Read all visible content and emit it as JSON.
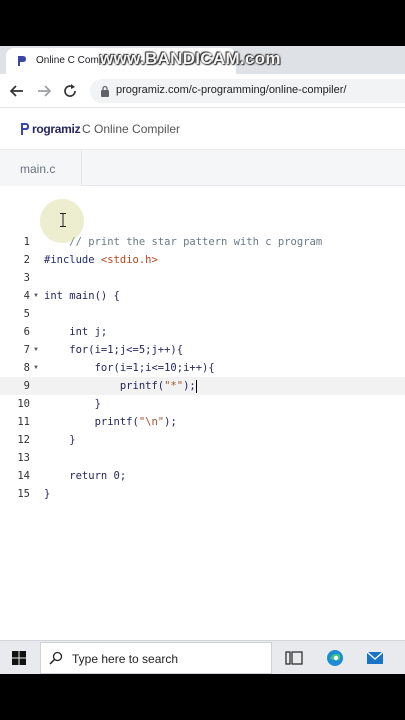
{
  "browser": {
    "tab_title": "Online C Compiler",
    "watermark": "www.BANDICAM.com",
    "url": "programiz.com/c-programming/online-compiler/"
  },
  "site": {
    "logo_text": "rogramiz",
    "title": "C Online Compiler"
  },
  "editor": {
    "file_tab": "main.c",
    "active_line": 9,
    "lines": [
      {
        "n": "1",
        "html": "    <span class=\"cm\">// print the star pattern with c program</span>",
        "fold": false
      },
      {
        "n": "2",
        "html": "<span class=\"pp\">#include</span> <span class=\"inc\">&lt;stdio.h&gt;</span>",
        "fold": false
      },
      {
        "n": "3",
        "html": "",
        "fold": false
      },
      {
        "n": "4",
        "html": "int main() {",
        "fold": true
      },
      {
        "n": "5",
        "html": "",
        "fold": false
      },
      {
        "n": "6",
        "html": "    int j;",
        "fold": false
      },
      {
        "n": "7",
        "html": "    for(i=1;j&lt;=5;j++){",
        "fold": true
      },
      {
        "n": "8",
        "html": "        for(i=1;i&lt;=10;i++){",
        "fold": true
      },
      {
        "n": "9",
        "html": "            printf(<span class=\"str\">\"*\"</span>);",
        "fold": false
      },
      {
        "n": "10",
        "html": "        }",
        "fold": false
      },
      {
        "n": "11",
        "html": "        printf(<span class=\"str\">\"\\n\"</span>);",
        "fold": false
      },
      {
        "n": "12",
        "html": "    }",
        "fold": false
      },
      {
        "n": "13",
        "html": "",
        "fold": false
      },
      {
        "n": "14",
        "html": "    return 0;",
        "fold": false
      },
      {
        "n": "15",
        "html": "}",
        "fold": false
      }
    ]
  },
  "taskbar": {
    "search_placeholder": "Type here to search"
  },
  "colors": {
    "accent": "#25265e",
    "tab_bg": "#dee1e6"
  }
}
